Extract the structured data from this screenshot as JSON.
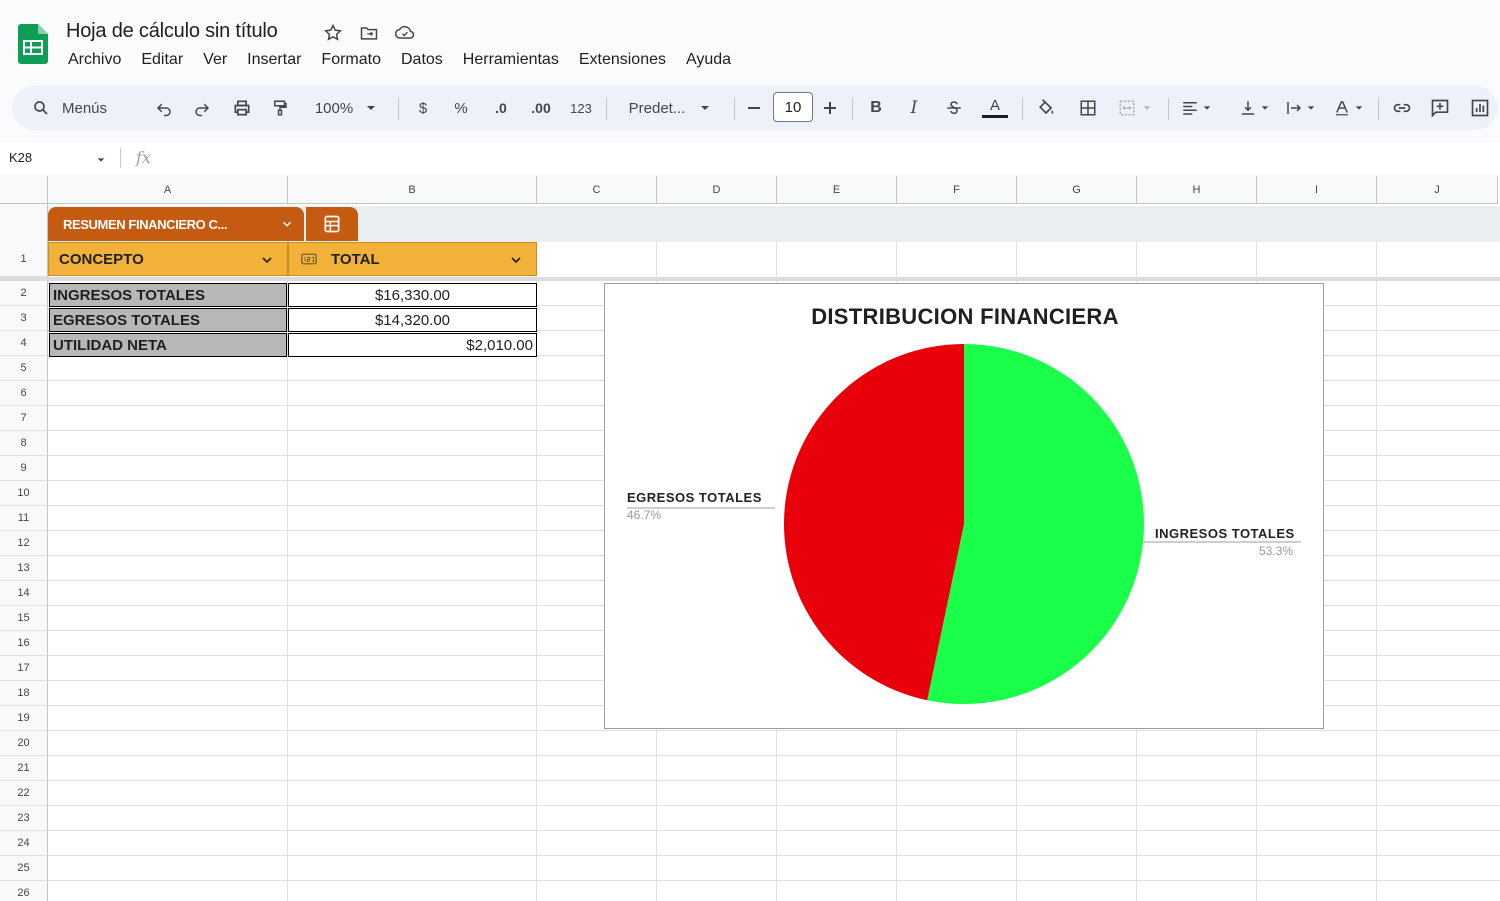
{
  "app": {
    "title": "Hoja de cálculo sin título",
    "menu": [
      "Archivo",
      "Editar",
      "Ver",
      "Insertar",
      "Formato",
      "Datos",
      "Herramientas",
      "Extensiones",
      "Ayuda"
    ]
  },
  "toolbar": {
    "search_label": "Menús",
    "zoom": "100%",
    "currency": "$",
    "percent": "%",
    "dec_decrease": ".0",
    "dec_increase": ".00",
    "number_format": "123",
    "font": "Predet...",
    "font_size": "10",
    "bold": "B",
    "italic": "I",
    "text_color": "A"
  },
  "formula_bar": {
    "cell_ref": "K28",
    "fx": "fx",
    "value": ""
  },
  "columns": [
    "A",
    "B",
    "C",
    "D",
    "E",
    "F",
    "G",
    "H",
    "I",
    "J"
  ],
  "rows": [
    "1",
    "2",
    "3",
    "4",
    "5",
    "6",
    "7",
    "8",
    "9",
    "10",
    "11",
    "12",
    "13",
    "14",
    "15",
    "16",
    "17",
    "18",
    "19",
    "20",
    "21",
    "22",
    "23",
    "24",
    "25",
    "26"
  ],
  "table": {
    "name": "RESUMEN FINANCIERO C...",
    "headers": [
      "CONCEPTO",
      "TOTAL"
    ],
    "rows": [
      {
        "concept": "INGRESOS TOTALES",
        "total": "$16,330.00"
      },
      {
        "concept": "EGRESOS TOTALES",
        "total": "$14,320.00"
      },
      {
        "concept": "UTILIDAD NETA",
        "total": "$2,010.00"
      }
    ]
  },
  "chart_data": {
    "type": "pie",
    "title": "DISTRIBUCION FINANCIERA",
    "categories": [
      "INGRESOS TOTALES",
      "EGRESOS TOTALES"
    ],
    "values": [
      16330,
      14320
    ],
    "percent_labels": [
      "53.3%",
      "46.7%"
    ],
    "colors": [
      "#19ff4a",
      "#e8000b"
    ],
    "legend": "none"
  }
}
